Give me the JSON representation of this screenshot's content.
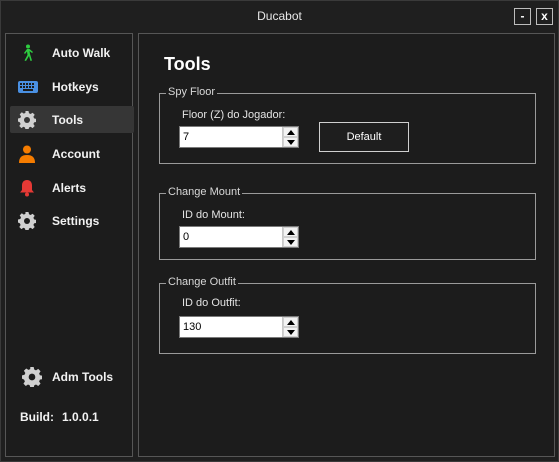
{
  "window": {
    "title": "Ducabot",
    "minimize_label": "-",
    "close_label": "x"
  },
  "sidebar": {
    "items": [
      {
        "label": "Auto Walk",
        "icon": "walk-icon",
        "color": "#2ecc40"
      },
      {
        "label": "Hotkeys",
        "icon": "keyboard-icon",
        "color": "#4a90e2"
      },
      {
        "label": "Tools",
        "icon": "gear-icon",
        "color": "#d0d0d0",
        "active": true
      },
      {
        "label": "Account",
        "icon": "person-icon",
        "color": "#f57c00"
      },
      {
        "label": "Alerts",
        "icon": "bell-icon",
        "color": "#e53935"
      },
      {
        "label": "Settings",
        "icon": "gear-icon",
        "color": "#d0d0d0"
      }
    ],
    "adm_tools": {
      "label": "Adm Tools",
      "icon": "gear-icon"
    },
    "build": {
      "label": "Build:",
      "version": "1.0.0.1"
    }
  },
  "main": {
    "title": "Tools",
    "spy_floor": {
      "legend": "Spy Floor",
      "field_label": "Floor (Z) do Jogador:",
      "value": "7",
      "default_button": "Default"
    },
    "change_mount": {
      "legend": "Change Mount",
      "field_label": "ID do Mount:",
      "value": "0"
    },
    "change_outfit": {
      "legend": "Change Outfit",
      "field_label": "ID do Outfit:",
      "value": "130"
    }
  }
}
